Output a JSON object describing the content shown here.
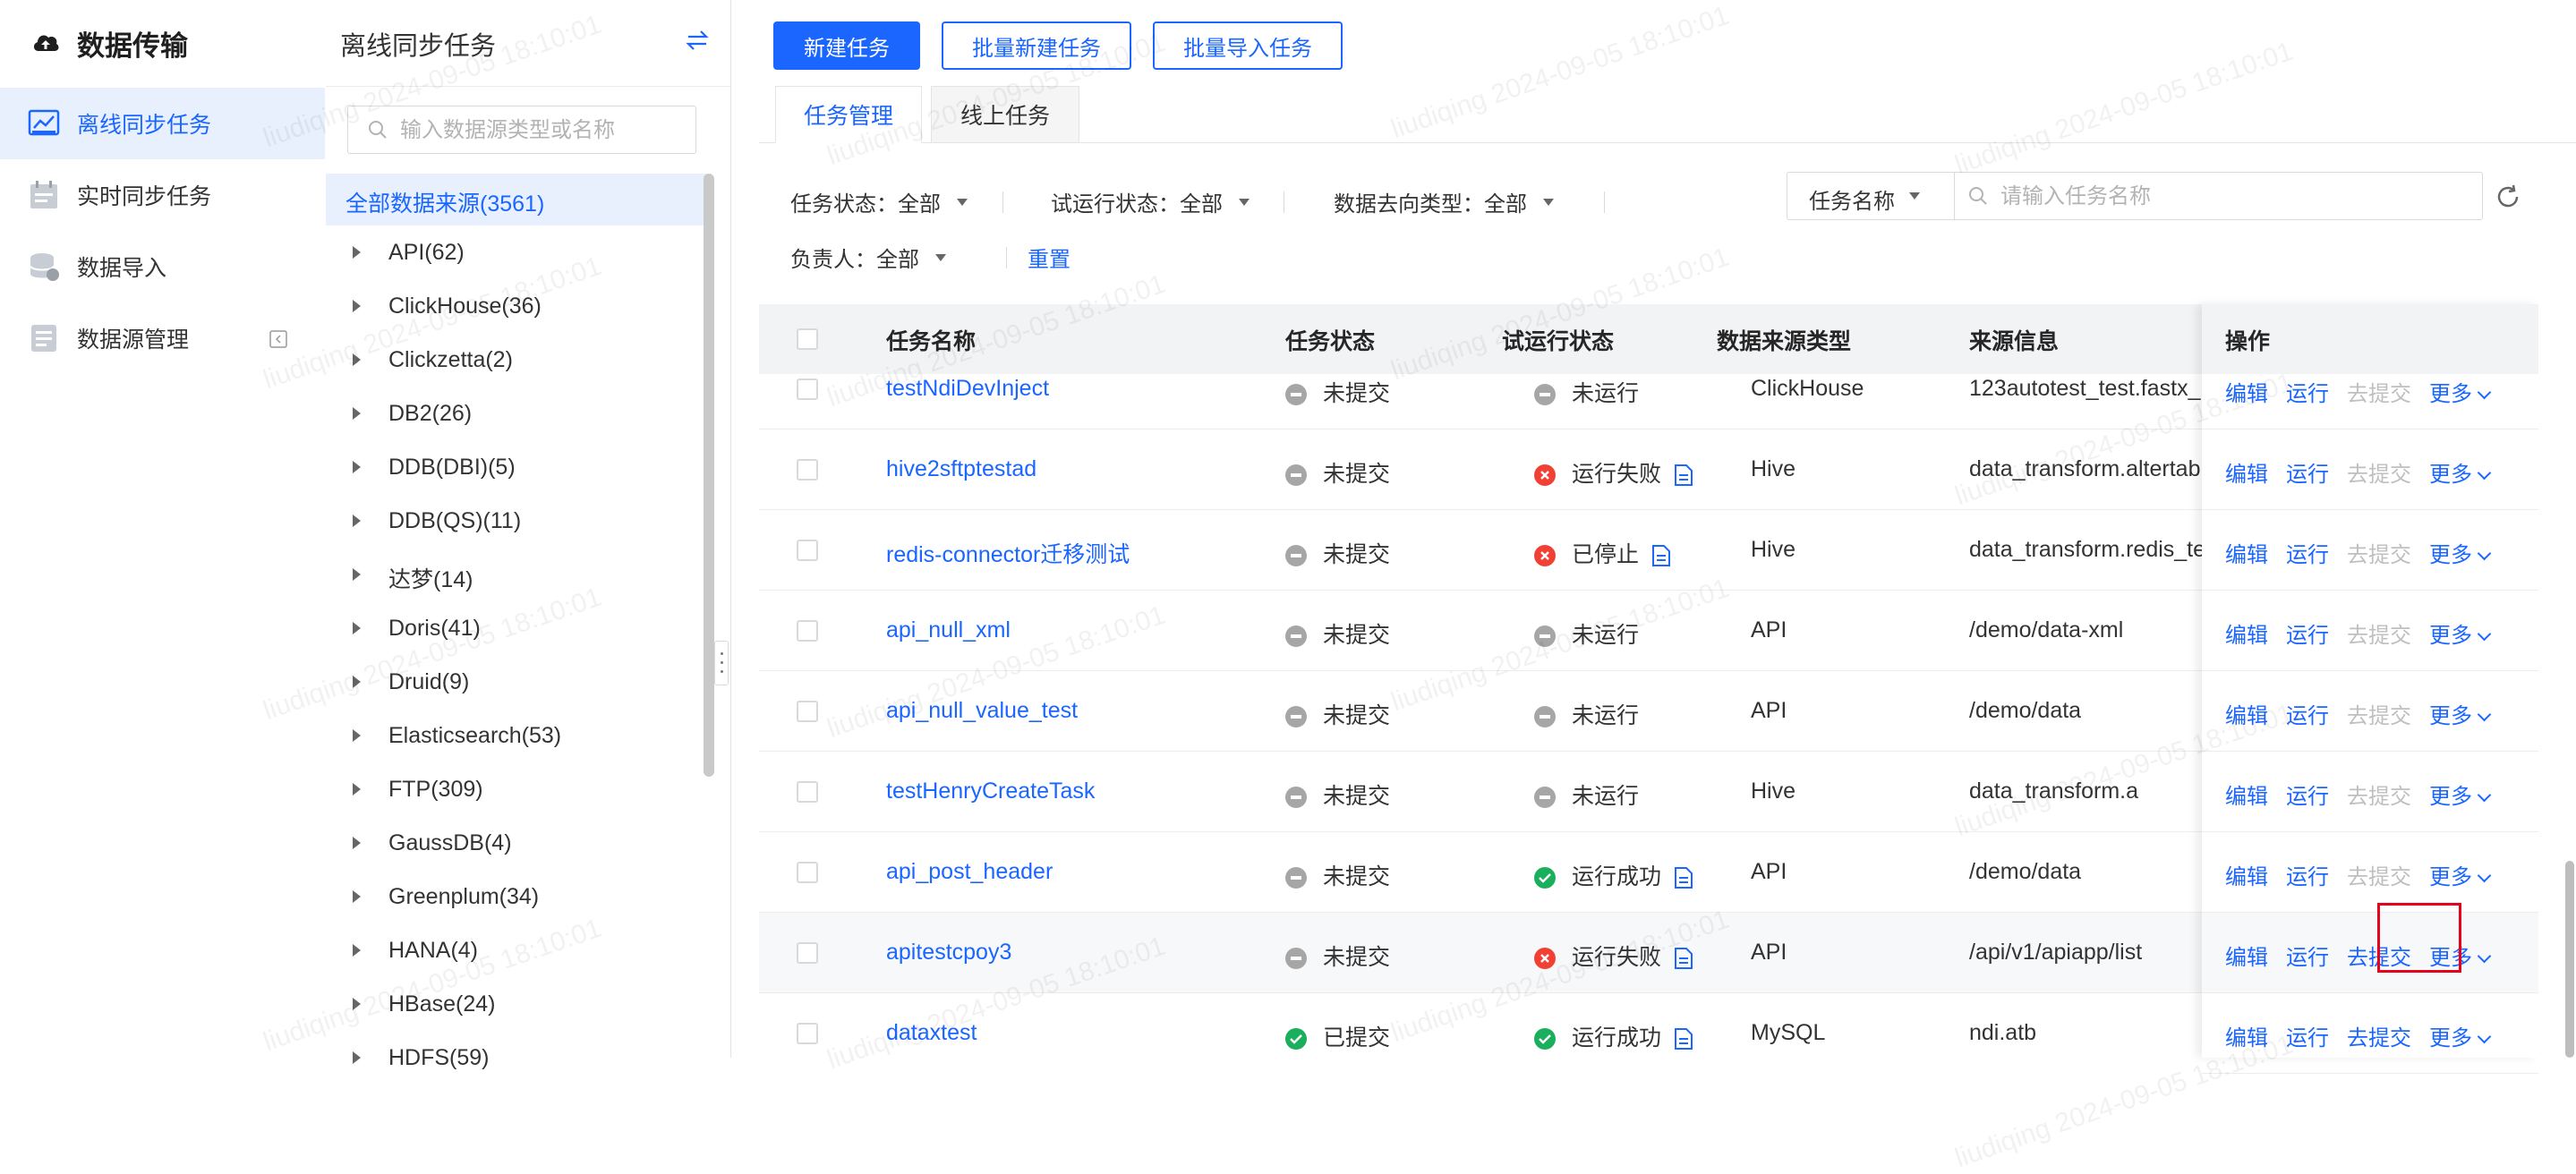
{
  "nav": {
    "brand": "数据传输",
    "items": [
      {
        "label": "离线同步任务",
        "icon": "offline-sync-icon",
        "active": true
      },
      {
        "label": "实时同步任务",
        "icon": "calendar-icon",
        "active": false
      },
      {
        "label": "数据导入",
        "icon": "database-import-icon",
        "active": false
      },
      {
        "label": "数据源管理",
        "icon": "datasource-icon",
        "active": false
      }
    ]
  },
  "tree": {
    "title": "离线同步任务",
    "search_placeholder": "输入数据源类型或名称",
    "all_label": "全部数据来源(3561)",
    "nodes": [
      "API(62)",
      "ClickHouse(36)",
      "Clickzetta(2)",
      "DB2(26)",
      "DDB(DBI)(5)",
      "DDB(QS)(11)",
      "达梦(14)",
      "Doris(41)",
      "Druid(9)",
      "Elasticsearch(53)",
      "FTP(309)",
      "GaussDB(4)",
      "Greenplum(34)",
      "HANA(4)",
      "HBase(24)",
      "HDFS(59)"
    ]
  },
  "toolbar": {
    "new_task": "新建任务",
    "batch_new": "批量新建任务",
    "batch_import": "批量导入任务"
  },
  "tabs": [
    "任务管理",
    "线上任务"
  ],
  "filters": {
    "task_status": "任务状态：全部",
    "trial_status": "试运行状态：全部",
    "dest_type": "数据去向类型：全部",
    "owner": "负责人：全部",
    "reset": "重置"
  },
  "search": {
    "type": "任务名称",
    "placeholder": "请输入任务名称"
  },
  "table": {
    "headers": [
      "任务名称",
      "任务状态",
      "试运行状态",
      "数据来源类型",
      "来源信息",
      "操作"
    ],
    "rows": [
      {
        "name": "testNdiDevInject",
        "status": "未提交",
        "trial": "未运行",
        "trial_state": "grey",
        "source_type": "ClickHouse",
        "source_info": "123autotest_test.fastx_"
      },
      {
        "name": "hive2sftptestad",
        "status": "未提交",
        "trial": "运行失败",
        "trial_state": "red",
        "source_type": "Hive",
        "source_info": "data_transform.altertab"
      },
      {
        "name": "redis-connector迁移测试",
        "status": "未提交",
        "trial": "已停止",
        "trial_state": "red",
        "source_type": "Hive",
        "source_info": "data_transform.redis_te"
      },
      {
        "name": "api_null_xml",
        "status": "未提交",
        "trial": "未运行",
        "trial_state": "grey",
        "source_type": "API",
        "source_info": "/demo/data-xml"
      },
      {
        "name": "api_null_value_test",
        "status": "未提交",
        "trial": "未运行",
        "trial_state": "grey",
        "source_type": "API",
        "source_info": "/demo/data"
      },
      {
        "name": "testHenryCreateTask",
        "status": "未提交",
        "trial": "未运行",
        "trial_state": "grey",
        "source_type": "Hive",
        "source_info": "data_transform.a"
      },
      {
        "name": "api_post_header",
        "status": "未提交",
        "trial": "运行成功",
        "trial_state": "green",
        "source_type": "API",
        "source_info": "/demo/data"
      },
      {
        "name": "apitestcpoy3",
        "status": "未提交",
        "trial": "运行失败",
        "trial_state": "red",
        "source_type": "API",
        "source_info": "/api/v1/apiapp/list"
      },
      {
        "name": "dataxtest",
        "status": "已提交",
        "trial": "运行成功",
        "trial_state": "green",
        "source_type": "MySQL",
        "source_info": "ndi.atb"
      }
    ],
    "ops": {
      "edit": "编辑",
      "run": "运行",
      "submit": "去提交",
      "more": "更多"
    }
  },
  "watermark": "liudiqing 2024-09-05 18:10:01",
  "colors": {
    "accent": "#1a66ff",
    "fail": "#f04134",
    "success": "#1aaf5d",
    "neutral": "#a6a6a6",
    "highlight_box": "#e5001c"
  }
}
